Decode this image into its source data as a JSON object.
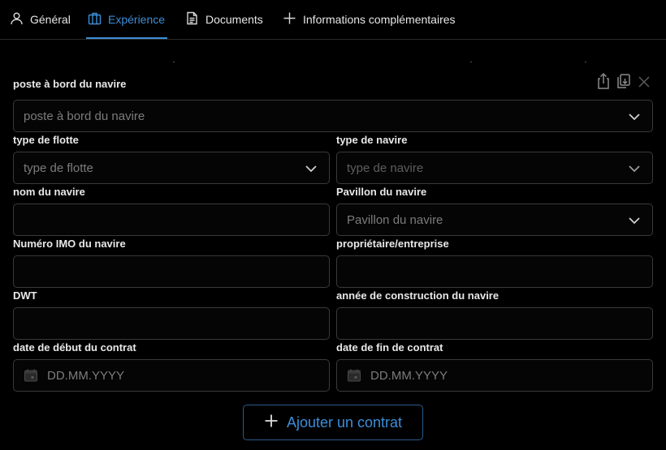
{
  "tabs": [
    {
      "label": "Général",
      "icon": "user-icon",
      "active": false
    },
    {
      "label": "Expérience",
      "icon": "briefcase-icon",
      "active": true
    },
    {
      "label": "Documents",
      "icon": "document-icon",
      "active": false
    },
    {
      "label": "Informations complémentaires",
      "icon": "plus-icon",
      "active": false
    }
  ],
  "form": {
    "position": {
      "label": "poste à bord du navire",
      "placeholder": "poste à bord du navire"
    },
    "fleet_type": {
      "label": "type de flotte",
      "placeholder": "type de flotte"
    },
    "vessel_type": {
      "label": "type de navire",
      "placeholder": "type de navire"
    },
    "vessel_name": {
      "label": "nom du navire",
      "value": ""
    },
    "flag": {
      "label": "Pavillon du navire",
      "placeholder": "Pavillon du navire"
    },
    "imo": {
      "label": "Numéro IMO du navire",
      "value": ""
    },
    "owner": {
      "label": "propriétaire/entreprise",
      "value": ""
    },
    "dwt": {
      "label": "DWT",
      "value": ""
    },
    "build_year": {
      "label": "année de construction du navire",
      "value": ""
    },
    "start_date": {
      "label": "date de début du contrat",
      "placeholder": "DD.MM.YYYY"
    },
    "end_date": {
      "label": "date de fin de contrat",
      "placeholder": "DD.MM.YYYY"
    }
  },
  "actions": {
    "add_contract_label": "Ajouter un contrat"
  },
  "colors": {
    "accent": "#3d8ed8",
    "background": "#000000",
    "border": "#3a3a3a"
  }
}
